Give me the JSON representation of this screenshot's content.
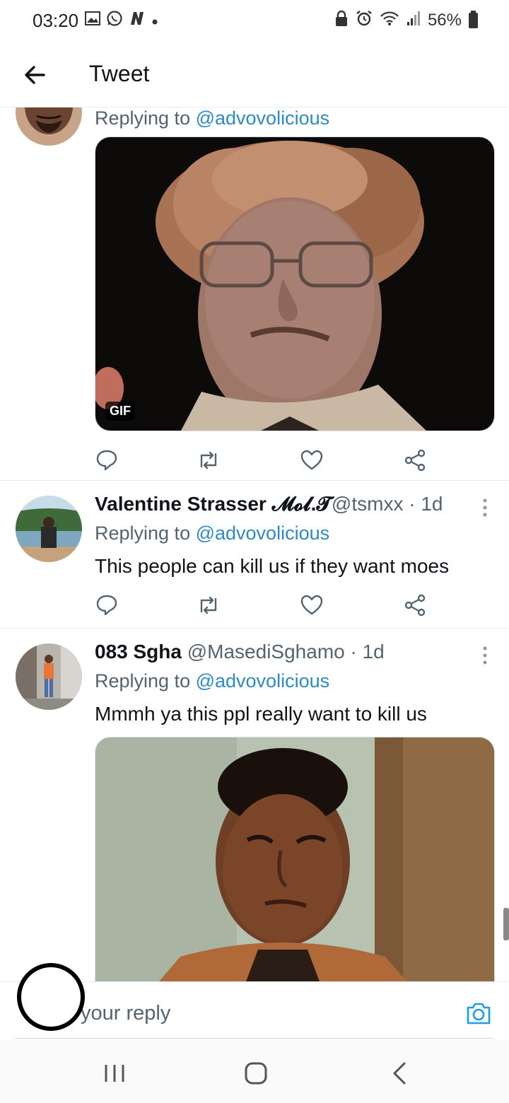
{
  "status_bar": {
    "time": "03:20",
    "battery": "56%",
    "left_icons": [
      "gallery-icon",
      "whatsapp-icon",
      "n-app-icon",
      "dot-icon"
    ],
    "right_icons": [
      "lock-icon",
      "alarm-icon",
      "wifi-icon",
      "signal-icon",
      "battery-icon"
    ]
  },
  "app_bar": {
    "title": "Tweet"
  },
  "tweets": [
    {
      "replying_label": "Replying to ",
      "replying_handle": "@advovolicious",
      "media_badge": "GIF"
    },
    {
      "name": "Valentine Strasser 𝓜𝓸𝓵.𝓣",
      "handle": "@tsmxx",
      "time": "· 1d",
      "replying_label": "Replying to ",
      "replying_handle": "@advovolicious",
      "text": "This people can kill us if they want moes"
    },
    {
      "name": "083 Sgha",
      "handle": "@MasediSghamo",
      "time": "· 1d",
      "replying_label": "Replying to ",
      "replying_handle": "@advovolicious",
      "text": "Mmmh ya this ppl really want to kill us"
    }
  ],
  "reply_bar": {
    "placeholder": "your reply"
  },
  "colors": {
    "link": "#2b8ac8",
    "muted": "#536471",
    "divider": "#e6ecf0"
  }
}
